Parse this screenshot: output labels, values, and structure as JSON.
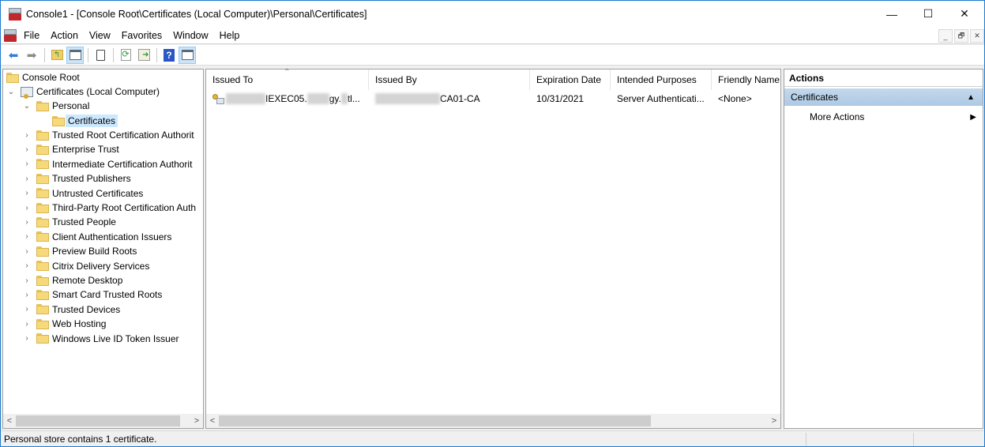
{
  "window": {
    "title": "Console1 - [Console Root\\Certificates (Local Computer)\\Personal\\Certificates]",
    "controls": {
      "minimize": "—",
      "maximize": "☐",
      "close": "✕"
    },
    "mdi_controls": {
      "minimize": "_",
      "restore": "🗗",
      "close": "✕"
    }
  },
  "menu": [
    "File",
    "Action",
    "View",
    "Favorites",
    "Window",
    "Help"
  ],
  "toolbar": [
    {
      "name": "back-button",
      "icon": "arrow-left-icon",
      "glyph": "⬅"
    },
    {
      "name": "forward-button",
      "icon": "arrow-right-icon",
      "glyph": "➡"
    },
    {
      "name": "up-one-level-button",
      "icon": "folder-up-icon",
      "glyph": "↰"
    },
    {
      "name": "show-hide-tree-button",
      "icon": "console-tree-icon",
      "glyph": "▥",
      "active": true
    },
    {
      "name": "export-list-button",
      "icon": "clipboard-icon",
      "glyph": "📋"
    },
    {
      "name": "refresh-button",
      "icon": "refresh-icon",
      "glyph": "⟳"
    },
    {
      "name": "export-button",
      "icon": "export-icon",
      "glyph": "⇨"
    },
    {
      "name": "help-button",
      "icon": "help-icon",
      "glyph": "?"
    },
    {
      "name": "show-hide-action-pane-button",
      "icon": "action-pane-icon",
      "glyph": "▥",
      "active": true
    }
  ],
  "tree": {
    "root": "Console Root",
    "snapin": "Certificates (Local Computer)",
    "personal": "Personal",
    "selected": "Certificates",
    "stores": [
      "Trusted Root Certification Authorit",
      "Enterprise Trust",
      "Intermediate Certification Authorit",
      "Trusted Publishers",
      "Untrusted Certificates",
      "Third-Party Root Certification Auth",
      "Trusted People",
      "Client Authentication Issuers",
      "Preview Build Roots",
      "Citrix Delivery Services",
      "Remote Desktop",
      "Smart Card Trusted Roots",
      "Trusted Devices",
      "Web Hosting",
      "Windows Live ID Token Issuer"
    ]
  },
  "list": {
    "columns": [
      "Issued To",
      "Issued By",
      "Expiration Date",
      "Intended Purposes",
      "Friendly Name"
    ],
    "sort_indicator": "^",
    "rows": [
      {
        "issued_to_visible": "IEXEC05.",
        "issued_to_mid": "gy.",
        "issued_to_end": "tl...",
        "issued_by_visible": "CA01-CA",
        "expiration": "10/31/2021",
        "purposes": "Server Authenticati...",
        "friendly_name": "<None>"
      }
    ]
  },
  "actions": {
    "header": "Actions",
    "section": "Certificates",
    "section_arrow": "▲",
    "items": [
      {
        "label": "More Actions",
        "arrow": "▶"
      }
    ]
  },
  "scroll": {
    "left": "<",
    "right": ">"
  },
  "status": {
    "text": "Personal store contains 1 certificate."
  }
}
